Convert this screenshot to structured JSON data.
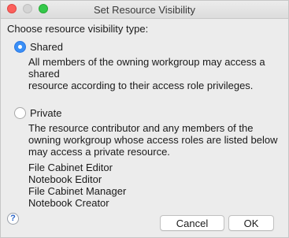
{
  "window": {
    "title": "Set Resource Visibility"
  },
  "prompt": "Choose resource visibility type:",
  "options": {
    "shared": {
      "label": "Shared",
      "selected": true,
      "description": [
        "All members of the owning workgroup may access a",
        "shared",
        "resource according to their access role privileges."
      ]
    },
    "private": {
      "label": "Private",
      "selected": false,
      "description": [
        "The resource contributor and any members of the",
        "owning workgroup whose access roles are listed below",
        "may access a private resource."
      ]
    }
  },
  "roles": [
    "File Cabinet Editor",
    "Notebook Editor",
    "File Cabinet Manager",
    "Notebook Creator"
  ],
  "help": {
    "glyph": "?"
  },
  "buttons": {
    "cancel": "Cancel",
    "ok": "OK"
  },
  "colors": {
    "accent": "#3a8ff6",
    "close": "#fc605c",
    "maximize": "#34c84a"
  }
}
